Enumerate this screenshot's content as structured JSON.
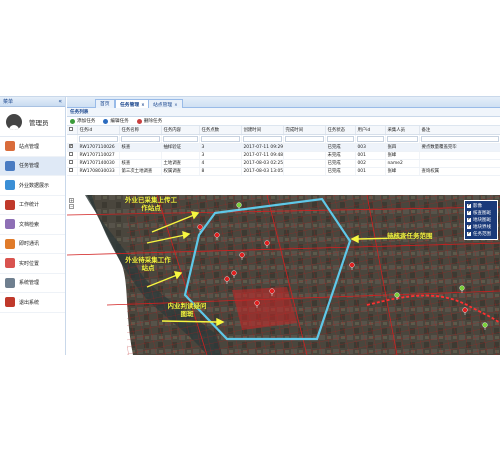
{
  "sidebar": {
    "header": "菜单",
    "collapse_icon": "«",
    "username": "管理员",
    "items": [
      {
        "label": "站点管理",
        "icon": "station-icon",
        "color": "#d96c3b",
        "active": false
      },
      {
        "label": "任务管理",
        "icon": "task-icon",
        "color": "#4a7cc2",
        "active": true
      },
      {
        "label": "外业数据展示",
        "icon": "data-display-icon",
        "color": "#3b8fd6",
        "active": false
      },
      {
        "label": "工作统计",
        "icon": "statistics-icon",
        "color": "#c0392b",
        "active": false
      },
      {
        "label": "文档检索",
        "icon": "document-search-icon",
        "color": "#8e6fb5",
        "active": false
      },
      {
        "label": "即时通讯",
        "icon": "chat-icon",
        "color": "#e07b2a",
        "active": false
      },
      {
        "label": "实时位置",
        "icon": "location-icon",
        "color": "#d9534f",
        "active": false
      },
      {
        "label": "系统管理",
        "icon": "system-icon",
        "color": "#6f7f8f",
        "active": false
      },
      {
        "label": "退出系统",
        "icon": "logout-icon",
        "color": "#c0392b",
        "active": false
      }
    ]
  },
  "tabs": [
    {
      "label": "首页",
      "closable": false,
      "active": false
    },
    {
      "label": "任务管理",
      "closable": true,
      "active": true
    },
    {
      "label": "站点管理",
      "closable": true,
      "active": false
    }
  ],
  "task_panel": {
    "title": "任务列表",
    "toolbar": [
      {
        "label": "添加任务",
        "icon": "add-icon",
        "color": "#3a9b3a"
      },
      {
        "label": "编辑任务",
        "icon": "edit-icon",
        "color": "#2b6bbf"
      },
      {
        "label": "删除任务",
        "icon": "delete-icon",
        "color": "#c94040"
      }
    ],
    "columns": [
      "任务id",
      "任务名称",
      "任务内容",
      "任务点数",
      "创建时间",
      "完成时间",
      "任务状态",
      "用户id",
      "采集人员",
      "备注"
    ],
    "rows": [
      {
        "checked": true,
        "cells": [
          "RW1707110026",
          "核查",
          "抽样验证",
          "3",
          "2017-07-11 09:29",
          "",
          "已完成",
          "003",
          "张四",
          "要点数量覆盖完毕"
        ]
      },
      {
        "checked": false,
        "cells": [
          "RW1707110027",
          "",
          "",
          "3",
          "2017-07-11 09:48",
          "",
          "未完成",
          "001",
          "张峰",
          ""
        ]
      },
      {
        "checked": false,
        "cells": [
          "RW1707140030",
          "核查",
          "土地调查",
          "4",
          "2017-08-03 02:25",
          "",
          "已完成",
          "002",
          "name2",
          ""
        ]
      },
      {
        "checked": false,
        "cells": [
          "RW1708030033",
          "第三次土地调查",
          "权属调查",
          "8",
          "2017-08-03 13:05",
          "",
          "已完成",
          "001",
          "张峰",
          "查询权属"
        ]
      }
    ]
  },
  "map": {
    "annotations": [
      {
        "text": "外业已采集上传工作站点"
      },
      {
        "text": "外业待采集工作站点"
      },
      {
        "text": "内业判读疑问图斑"
      },
      {
        "text": "待核查任务范围"
      }
    ],
    "layers": [
      {
        "label": "影像",
        "checked": true
      },
      {
        "label": "核查图斑",
        "checked": true
      },
      {
        "label": "地块图斑",
        "checked": true
      },
      {
        "label": "地块界线",
        "checked": true
      },
      {
        "label": "任务范围",
        "checked": true
      }
    ],
    "colors": {
      "task_boundary": "#5fc8e8",
      "parcel_lines": "#d12020",
      "annotation": "#f7f740",
      "uploaded_marker": "#7bd13a",
      "pending_marker": "#e02020"
    }
  }
}
